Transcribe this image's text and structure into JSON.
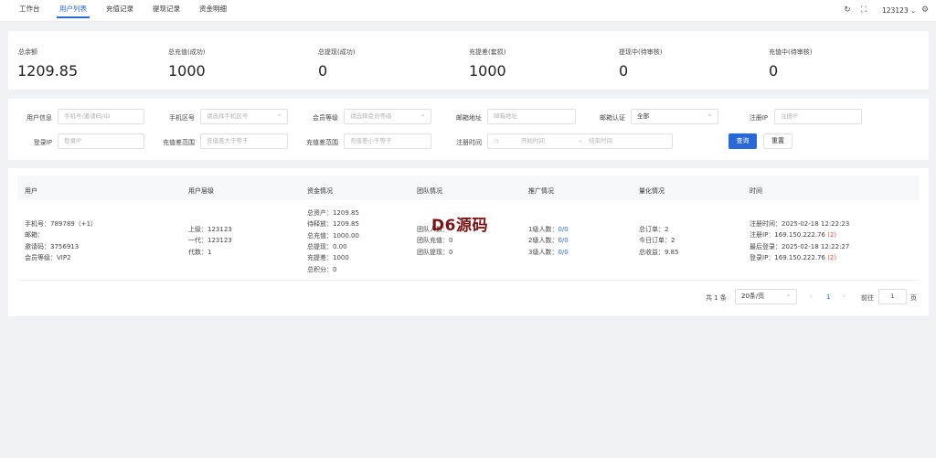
{
  "tabs": [
    {
      "label": "工作台"
    },
    {
      "label": "用户列表"
    },
    {
      "label": "充值记录"
    },
    {
      "label": "提现记录"
    },
    {
      "label": "资金明细"
    }
  ],
  "header": {
    "username": "123123",
    "accent": "#2a68d8"
  },
  "stats": [
    {
      "label": "总余额",
      "value": "1209.85"
    },
    {
      "label": "总充值(成功)",
      "value": "1000"
    },
    {
      "label": "总提现(成功)",
      "value": "0"
    },
    {
      "label": "充提差(套损)",
      "value": "1000"
    },
    {
      "label": "提现中(待审核)",
      "value": "0"
    },
    {
      "label": "充值中(待审核)",
      "value": "0"
    }
  ],
  "filters": {
    "user_info": {
      "label": "用户信息",
      "placeholder": "手机号/邀请码/ID"
    },
    "area_code": {
      "label": "手机区号",
      "placeholder": "请选择手机区号"
    },
    "level": {
      "label": "会员等级",
      "placeholder": "请选择会员等级"
    },
    "email": {
      "label": "邮箱地址",
      "placeholder": "邮箱地址"
    },
    "email_verify": {
      "label": "邮箱认证",
      "value": "全部"
    },
    "reg_ip": {
      "label": "注册IP",
      "placeholder": "注册IP"
    },
    "login_ip": {
      "label": "登录IP",
      "placeholder": "登录IP"
    },
    "diff_min": {
      "label": "充值差范围",
      "placeholder": "充值差大于等于"
    },
    "diff_max": {
      "label": "充值差范围",
      "placeholder": "充值差小于等于"
    },
    "reg_time": {
      "label": "注册时间",
      "start": "开始时间",
      "sep": "-",
      "end": "结束时间"
    },
    "search_label": "查询",
    "reset_label": "重置"
  },
  "table": {
    "headers": [
      "用户",
      "用户层级",
      "资金情况",
      "团队情况",
      "推广情况",
      "量化情况",
      "时间"
    ],
    "row": {
      "user": [
        "手机号：789789（+1）",
        "邮箱：",
        "邀请码：3756913",
        "会员等级：VIP2"
      ],
      "hierarchy": [
        "上级：123123",
        "一代：123123",
        "代数：1"
      ],
      "funds": [
        "总资产：1209.85",
        "待释放：1209.85",
        "总充值：1000.00",
        "总提现：0.00",
        "充提差：1000",
        "总积分：0"
      ],
      "team": [
        "团队人数：",
        "团队充值：0",
        "团队提现：0"
      ],
      "promo": [
        {
          "label": "1级人数：",
          "value": "0/0"
        },
        {
          "label": "2级人数：",
          "value": "0/0"
        },
        {
          "label": "3级人数：",
          "value": "0/0"
        }
      ],
      "quant": [
        "总订单：2",
        "今日订单：2",
        "总收益：9.85"
      ],
      "time": [
        {
          "text": "注册时间：2025-02-18 12:22:23",
          "extra": ""
        },
        {
          "text": "注册IP：169.150.222.76 ",
          "extra": "(2)"
        },
        {
          "text": "最后登录：2025-02-18 12:22:27",
          "extra": ""
        },
        {
          "text": "登录IP：169.150.222.76 ",
          "extra": "(2)"
        }
      ]
    }
  },
  "pagination": {
    "total": "共 1 条",
    "page_size": "20条/页",
    "prev": "‹",
    "current": "1",
    "next": "›",
    "goto_label": "前往",
    "goto_value": "1",
    "page_unit": "页"
  },
  "watermark": "D6源码"
}
